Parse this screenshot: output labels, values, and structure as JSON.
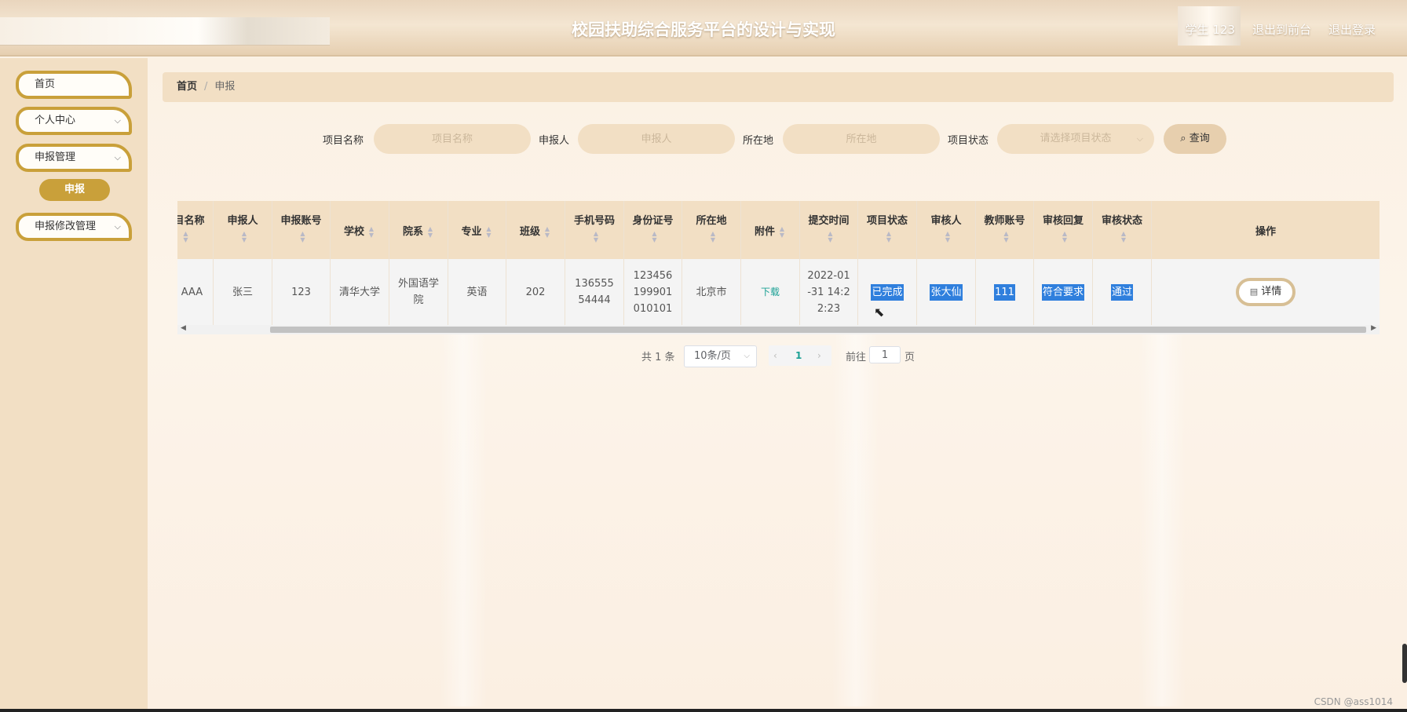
{
  "header": {
    "title": "校园扶助综合服务平台的设计与实现",
    "user": "学生 123",
    "to_front": "退出到前台",
    "logout": "退出登录"
  },
  "sidebar": {
    "items": [
      {
        "label": "首页"
      },
      {
        "label": "个人中心"
      },
      {
        "label": "申报管理"
      },
      {
        "label": "申报"
      },
      {
        "label": "申报修改管理"
      }
    ]
  },
  "breadcrumb": {
    "home": "首页",
    "separator": "/",
    "current": "申报"
  },
  "search": {
    "name_label": "项目名称",
    "name_placeholder": "项目名称",
    "applicant_label": "申报人",
    "applicant_placeholder": "申报人",
    "location_label": "所在地",
    "location_placeholder": "所在地",
    "status_label": "项目状态",
    "status_placeholder": "请选择项目状态",
    "query_button": "查询"
  },
  "table": {
    "headers": [
      "项目名称",
      "申报人",
      "申报账号",
      "学校",
      "院系",
      "专业",
      "班级",
      "手机号码",
      "身份证号",
      "所在地",
      "附件",
      "提交时间",
      "项目状态",
      "审核人",
      "教师账号",
      "审核回复",
      "审核状态",
      "操作"
    ],
    "row": {
      "project_name": "AAA",
      "applicant": "张三",
      "account": "123",
      "school": "清华大学",
      "department": "外国语学院",
      "major": "英语",
      "class": "202",
      "phone": "13655554444",
      "id_card": "123456199901010101",
      "location": "北京市",
      "attachment": "下载",
      "submit_time": "2022-01-31 14:22:23",
      "project_status": "已完成",
      "reviewer": "张大仙",
      "teacher_account": "111",
      "review_reply": "符合要求",
      "review_status": "通过",
      "detail_button": "详情"
    }
  },
  "pagination": {
    "total": "共 1 条",
    "page_size": "10条/页",
    "current_page": "1",
    "goto_label": "前往",
    "goto_value": "1",
    "page_unit": "页"
  },
  "watermark": "CSDN @ass1014"
}
